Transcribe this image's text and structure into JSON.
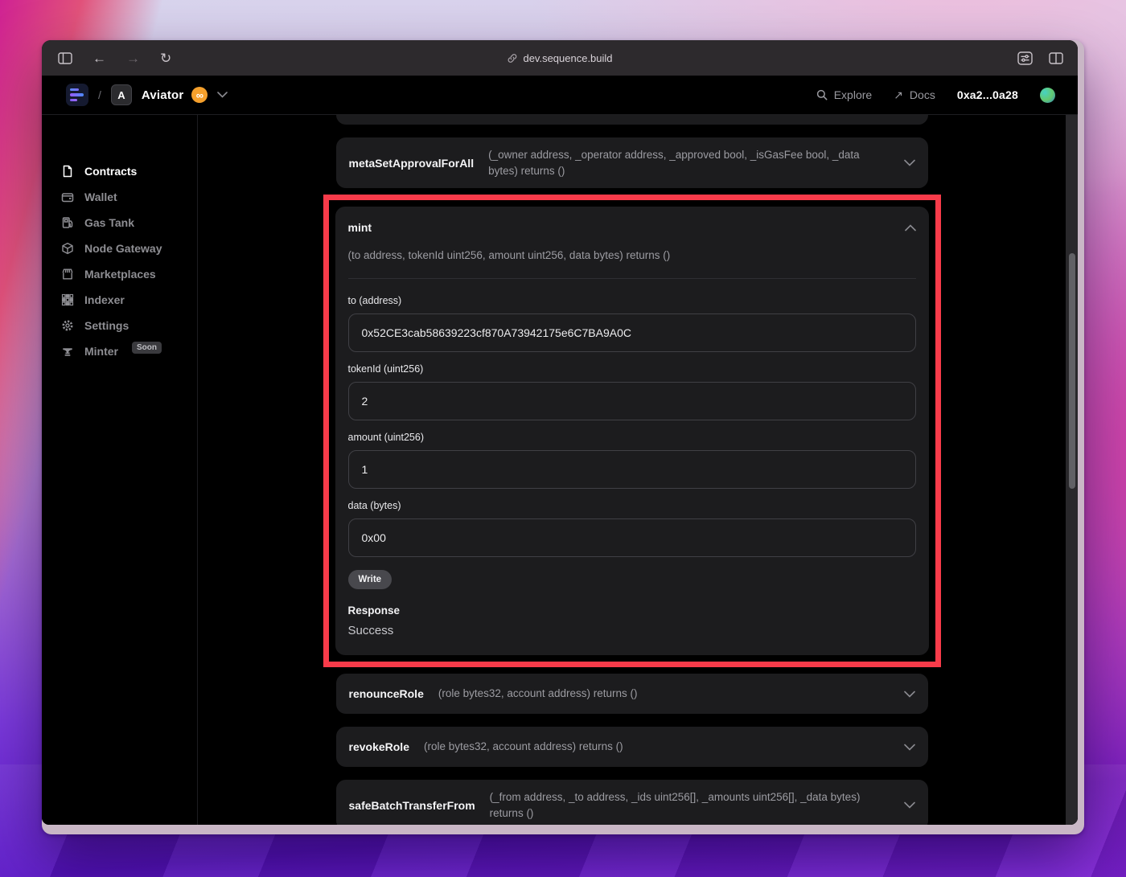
{
  "browser": {
    "url": "dev.sequence.build",
    "glyphs": {
      "back": "←",
      "forward": "→",
      "reload": "↻"
    }
  },
  "header": {
    "slash": "/",
    "project_initial": "A",
    "project_name": "Aviator",
    "network_badge_glyph": "∞",
    "explore_label": "Explore",
    "docs_label": "Docs",
    "docs_arrow_glyph": "↗",
    "account_address": "0xa2...0a28"
  },
  "sidebar": {
    "items": [
      {
        "label": "Contracts",
        "icon": "contracts-icon",
        "active": true
      },
      {
        "label": "Wallet",
        "icon": "wallet-icon",
        "active": false
      },
      {
        "label": "Gas Tank",
        "icon": "gas-tank-icon",
        "active": false
      },
      {
        "label": "Node Gateway",
        "icon": "node-gateway-icon",
        "active": false
      },
      {
        "label": "Marketplaces",
        "icon": "marketplaces-icon",
        "active": false
      },
      {
        "label": "Indexer",
        "icon": "indexer-icon",
        "active": false
      },
      {
        "label": "Settings",
        "icon": "settings-icon",
        "active": false
      },
      {
        "label": "Minter",
        "icon": "minter-icon",
        "active": false,
        "badge": "Soon"
      }
    ]
  },
  "main": {
    "functions": [
      {
        "name": "metaSetApprovalForAll",
        "signature": "(_owner address, _operator address, _approved bool, _isGasFee bool, _data bytes) returns ()",
        "expanded": false
      },
      {
        "name": "mint",
        "signature": "(to address, tokenId uint256, amount uint256, data bytes) returns ()",
        "expanded": true,
        "fields": [
          {
            "label": "to (address)",
            "value": "0x52CE3cab58639223cf870A73942175e6C7BA9A0C"
          },
          {
            "label": "tokenId (uint256)",
            "value": "2"
          },
          {
            "label": "amount (uint256)",
            "value": "1"
          },
          {
            "label": "data (bytes)",
            "value": "0x00"
          }
        ],
        "write_label": "Write",
        "response_label": "Response",
        "response_value": "Success"
      },
      {
        "name": "renounceRole",
        "signature": "(role bytes32, account address) returns ()",
        "expanded": false
      },
      {
        "name": "revokeRole",
        "signature": "(role bytes32, account address) returns ()",
        "expanded": false
      },
      {
        "name": "safeBatchTransferFrom",
        "signature": "(_from address, _to address, _ids uint256[], _amounts uint256[], _data bytes) returns ()",
        "expanded": false
      }
    ]
  },
  "colors": {
    "annotation_red": "#f83b4a",
    "badge_orange": "#f5a02c",
    "card_bg": "#1c1c1e"
  }
}
